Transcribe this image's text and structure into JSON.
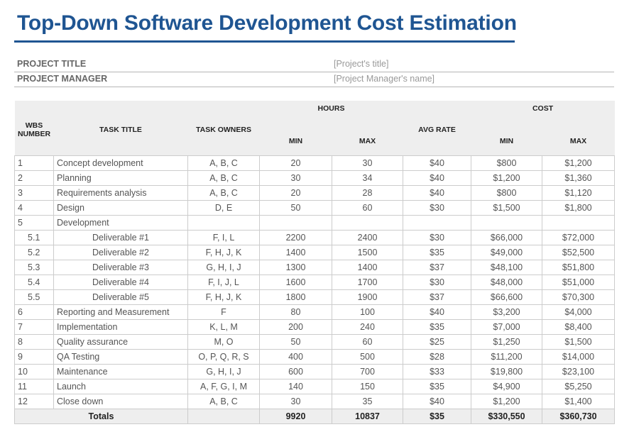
{
  "header": {
    "title": "Top-Down Software Development Cost Estimation",
    "accent_color": "#1f5592"
  },
  "project": {
    "title_label": "PROJECT TITLE",
    "title_value": "[Project's title]",
    "manager_label": "PROJECT MANAGER",
    "manager_value": "[Project Manager's name]"
  },
  "table": {
    "headers": {
      "wbs": "WBS NUMBER",
      "task_title": "TASK TITLE",
      "task_owners": "TASK OWNERS",
      "hours": "HOURS",
      "hours_min": "MIN",
      "hours_max": "MAX",
      "avg_rate": "AVG RATE",
      "cost": "COST",
      "cost_min": "MIN",
      "cost_max": "MAX"
    },
    "rows": [
      {
        "wbs": "1",
        "title": "Concept development",
        "owners": "A, B, C",
        "hmin": "20",
        "hmax": "30",
        "rate": "$40",
        "cmin": "$800",
        "cmax": "$1,200"
      },
      {
        "wbs": "2",
        "title": "Planning",
        "owners": "A, B, C",
        "hmin": "30",
        "hmax": "34",
        "rate": "$40",
        "cmin": "$1,200",
        "cmax": "$1,360"
      },
      {
        "wbs": "3",
        "title": "Requirements analysis",
        "owners": "A, B, C",
        "hmin": "20",
        "hmax": "28",
        "rate": "$40",
        "cmin": "$800",
        "cmax": "$1,120"
      },
      {
        "wbs": "4",
        "title": "Design",
        "owners": "D, E",
        "hmin": "50",
        "hmax": "60",
        "rate": "$30",
        "cmin": "$1,500",
        "cmax": "$1,800"
      },
      {
        "wbs": "5",
        "title": "Development",
        "owners": "",
        "hmin": "",
        "hmax": "",
        "rate": "",
        "cmin": "",
        "cmax": ""
      },
      {
        "wbs": "5.1",
        "title": "Deliverable #1",
        "owners": "F, I, L",
        "hmin": "2200",
        "hmax": "2400",
        "rate": "$30",
        "cmin": "$66,000",
        "cmax": "$72,000",
        "sub": true
      },
      {
        "wbs": "5.2",
        "title": "Deliverable #2",
        "owners": "F, H, J, K",
        "hmin": "1400",
        "hmax": "1500",
        "rate": "$35",
        "cmin": "$49,000",
        "cmax": "$52,500",
        "sub": true
      },
      {
        "wbs": "5.3",
        "title": "Deliverable #3",
        "owners": "G, H, I, J",
        "hmin": "1300",
        "hmax": "1400",
        "rate": "$37",
        "cmin": "$48,100",
        "cmax": "$51,800",
        "sub": true
      },
      {
        "wbs": "5.4",
        "title": "Deliverable #4",
        "owners": "F, I, J, L",
        "hmin": "1600",
        "hmax": "1700",
        "rate": "$30",
        "cmin": "$48,000",
        "cmax": "$51,000",
        "sub": true
      },
      {
        "wbs": "5.5",
        "title": "Deliverable #5",
        "owners": "F, H, J, K",
        "hmin": "1800",
        "hmax": "1900",
        "rate": "$37",
        "cmin": "$66,600",
        "cmax": "$70,300",
        "sub": true
      },
      {
        "wbs": "6",
        "title": "Reporting and Measurement",
        "owners": "F",
        "hmin": "80",
        "hmax": "100",
        "rate": "$40",
        "cmin": "$3,200",
        "cmax": "$4,000"
      },
      {
        "wbs": "7",
        "title": "Implementation",
        "owners": "K, L, M",
        "hmin": "200",
        "hmax": "240",
        "rate": "$35",
        "cmin": "$7,000",
        "cmax": "$8,400"
      },
      {
        "wbs": "8",
        "title": "Quality assurance",
        "owners": "M, O",
        "hmin": "50",
        "hmax": "60",
        "rate": "$25",
        "cmin": "$1,250",
        "cmax": "$1,500"
      },
      {
        "wbs": "9",
        "title": "QA Testing",
        "owners": "O, P, Q, R, S",
        "hmin": "400",
        "hmax": "500",
        "rate": "$28",
        "cmin": "$11,200",
        "cmax": "$14,000"
      },
      {
        "wbs": "10",
        "title": "Maintenance",
        "owners": "G, H, I, J",
        "hmin": "600",
        "hmax": "700",
        "rate": "$33",
        "cmin": "$19,800",
        "cmax": "$23,100"
      },
      {
        "wbs": "11",
        "title": "Launch",
        "owners": "A, F, G, I, M",
        "hmin": "140",
        "hmax": "150",
        "rate": "$35",
        "cmin": "$4,900",
        "cmax": "$5,250"
      },
      {
        "wbs": "12",
        "title": "Close down",
        "owners": "A, B, C",
        "hmin": "30",
        "hmax": "35",
        "rate": "$40",
        "cmin": "$1,200",
        "cmax": "$1,400"
      }
    ],
    "totals": {
      "label": "Totals",
      "owners": "",
      "hmin": "9920",
      "hmax": "10837",
      "rate": "$35",
      "cmin": "$330,550",
      "cmax": "$360,730"
    }
  }
}
